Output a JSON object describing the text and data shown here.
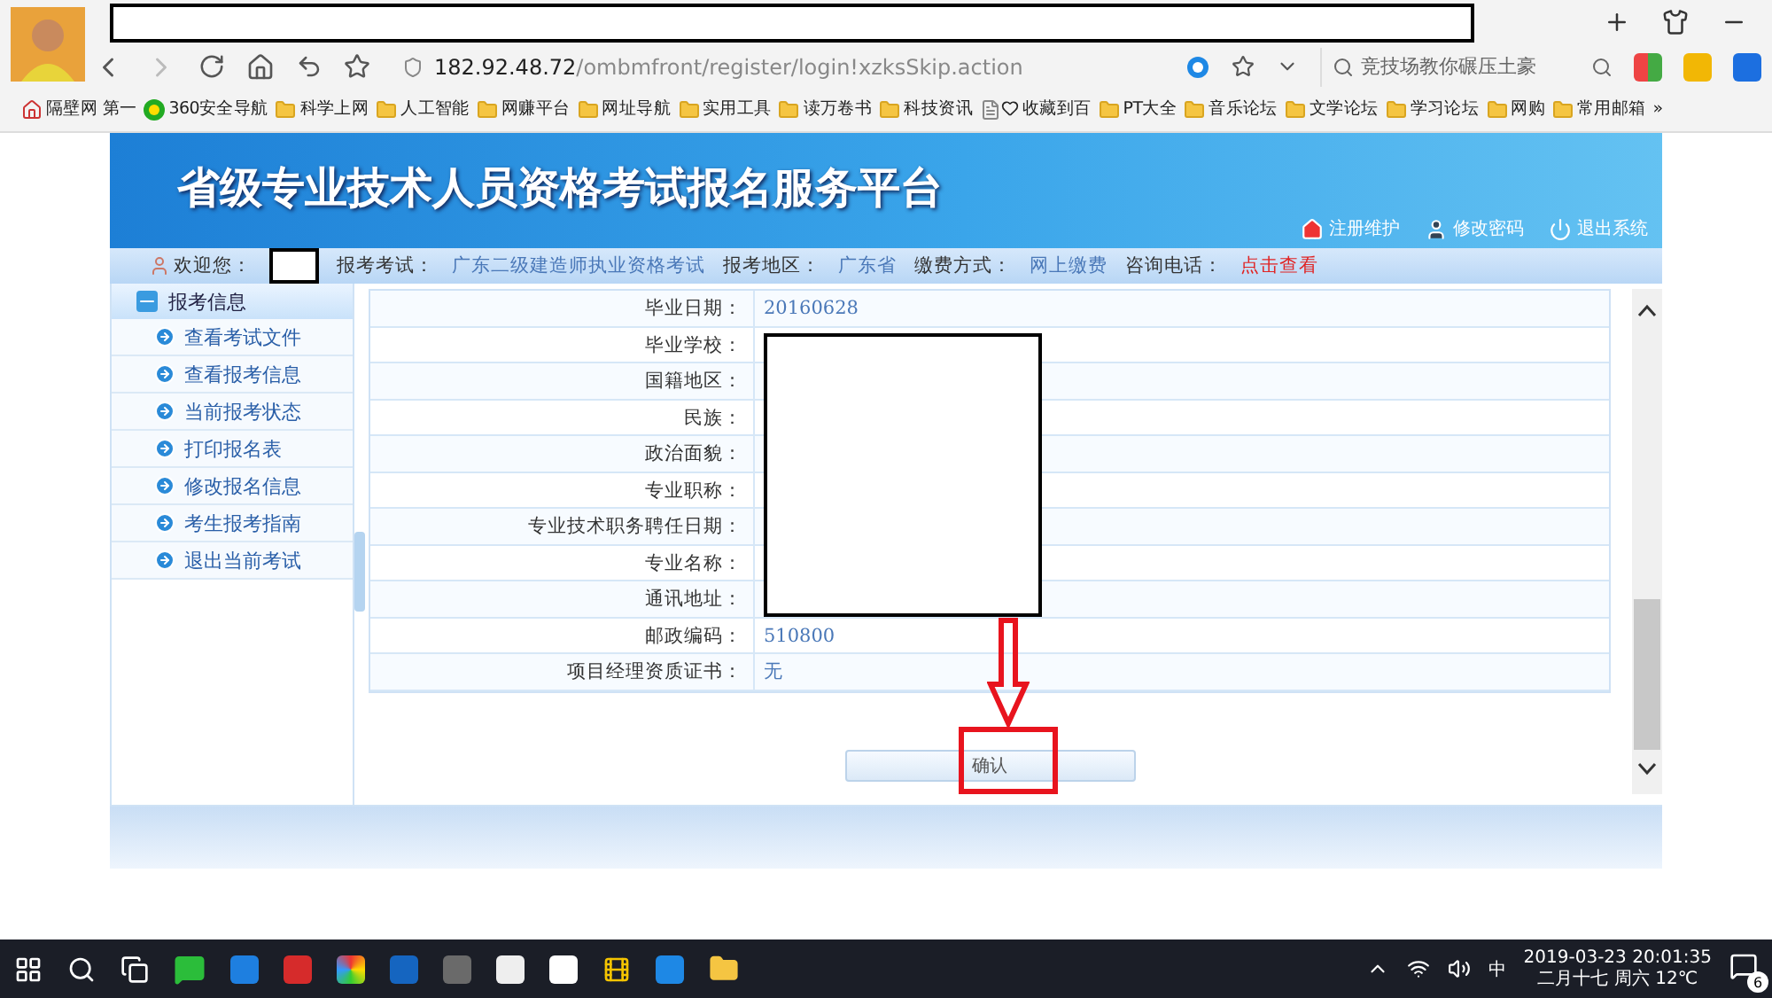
{
  "browser": {
    "url_host": "182.92.48.72",
    "url_path": "/ombmfront/register/login!xzksSkip.action",
    "search_placeholder": "竞技场教你碾压土豪",
    "bookmarks": [
      {
        "label": "隔壁网 第一",
        "kind": "home"
      },
      {
        "label": "360安全导航",
        "kind": "site"
      },
      {
        "label": "科学上网",
        "kind": "folder"
      },
      {
        "label": "人工智能",
        "kind": "folder"
      },
      {
        "label": "网赚平台",
        "kind": "folder"
      },
      {
        "label": "网址导航",
        "kind": "folder"
      },
      {
        "label": "实用工具",
        "kind": "folder"
      },
      {
        "label": "读万卷书",
        "kind": "folder"
      },
      {
        "label": "科技资讯",
        "kind": "folder"
      },
      {
        "label": "收藏到百",
        "kind": "page"
      },
      {
        "label": "PT大全",
        "kind": "folder"
      },
      {
        "label": "音乐论坛",
        "kind": "folder"
      },
      {
        "label": "文学论坛",
        "kind": "folder"
      },
      {
        "label": "学习论坛",
        "kind": "folder"
      },
      {
        "label": "网购",
        "kind": "folder"
      },
      {
        "label": "常用邮箱",
        "kind": "folder"
      }
    ],
    "more": "»"
  },
  "page": {
    "title": "省级专业技术人员资格考试报名服务平台",
    "header_links": [
      {
        "label": "注册维护",
        "kind": "home"
      },
      {
        "label": "修改密码",
        "kind": "user"
      },
      {
        "label": "退出系统",
        "kind": "power"
      }
    ],
    "info_bar": [
      {
        "label": "欢迎您：",
        "kind": "hidden"
      },
      {
        "label": "报考考试：",
        "value": "广东二级建造师执业资格考试",
        "kind": "text"
      },
      {
        "label": "报考地区：",
        "value": "广东省",
        "kind": "text"
      },
      {
        "label": "缴费方式：",
        "value": "网上缴费",
        "kind": "text"
      },
      {
        "label": "咨询电话：",
        "value": "点击查看",
        "kind": "link"
      }
    ],
    "sidebar": {
      "header": "报考信息",
      "expanded": true,
      "items": [
        {
          "label": "查看考试文件"
        },
        {
          "label": "查看报考信息"
        },
        {
          "label": "当前报考状态"
        },
        {
          "label": "打印报名表"
        },
        {
          "label": "修改报名信息"
        },
        {
          "label": "考生报考指南"
        },
        {
          "label": "退出当前考试"
        }
      ]
    },
    "form_rows": [
      {
        "label": "毕业日期：",
        "value": "20160628"
      },
      {
        "label": "毕业学校："
      },
      {
        "label": "国籍地区："
      },
      {
        "label": "民族："
      },
      {
        "label": "政治面貌："
      },
      {
        "label": "专业职称："
      },
      {
        "label": "专业技术职务聘任日期："
      },
      {
        "label": "专业名称："
      },
      {
        "label": "通讯地址："
      },
      {
        "label": "邮政编码：",
        "value": "510800"
      },
      {
        "label": "项目经理资质证书：",
        "value": "无"
      }
    ],
    "confirm_button": "确认"
  },
  "taskbar": {
    "ime": "中",
    "datetime": "2019-03-23 20:01:35",
    "lunar": "二月十七 周六 12℃",
    "notifications": "6"
  }
}
